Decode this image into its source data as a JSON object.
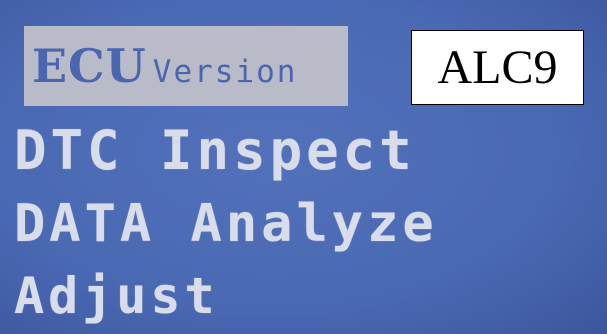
{
  "screen": {
    "background_color": "#4a69b3",
    "text_color": "#d9ddea",
    "highlight_color": "#b9bcc8"
  },
  "menu": {
    "items": [
      {
        "first": "ECU",
        "rest": "Version",
        "selected": true
      },
      {
        "label": "DTC Inspect"
      },
      {
        "label": "DATA Analyze"
      },
      {
        "label": "Adjust"
      }
    ]
  },
  "badge": {
    "label": "ALC9"
  }
}
